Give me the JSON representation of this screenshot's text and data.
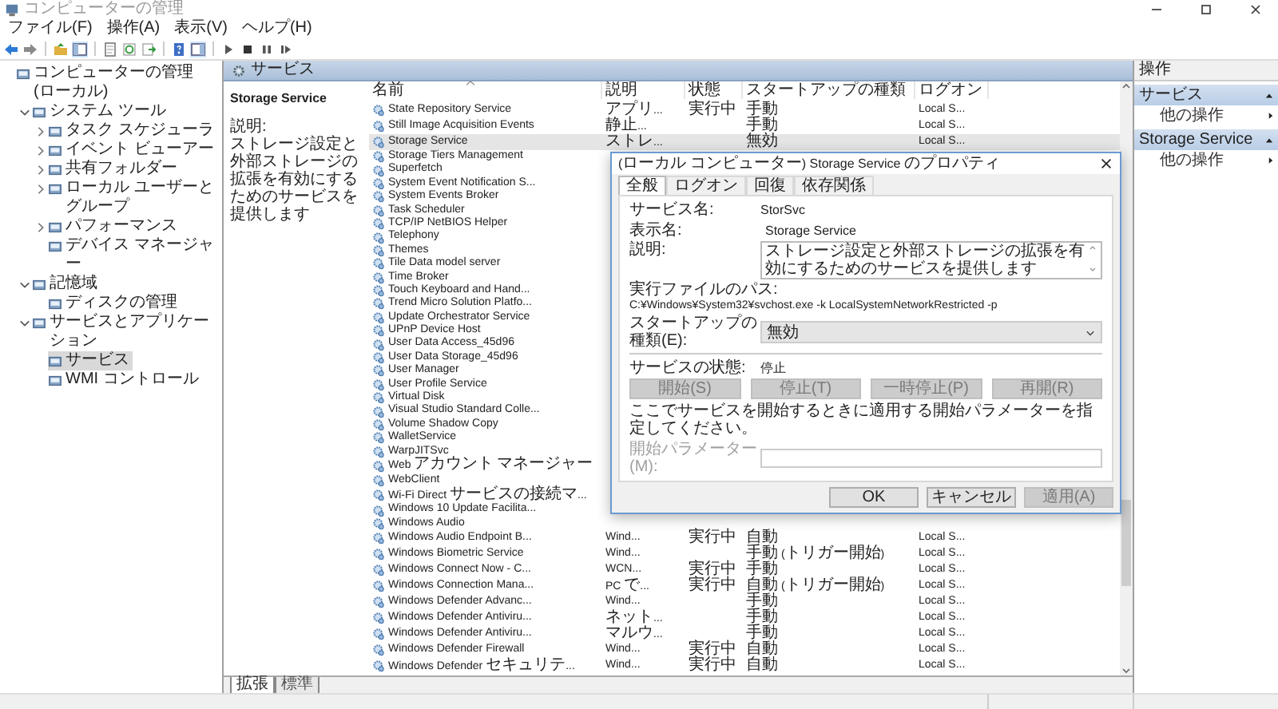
{
  "window": {
    "title": "コンピューターの管理"
  },
  "menu": [
    "ファイル(F)",
    "操作(A)",
    "表示(V)",
    "ヘルプ(H)"
  ],
  "tree": [
    {
      "label": "コンピューターの管理 (ローカル)",
      "selected": false,
      "children": [
        {
          "label": "システム ツール",
          "selected": false,
          "expanded": true,
          "children": [
            {
              "label": "タスク スケジューラ",
              "selected": false,
              "expanded": false
            },
            {
              "label": "イベント ビューアー",
              "selected": false,
              "expanded": false
            },
            {
              "label": "共有フォルダー",
              "selected": false,
              "expanded": false
            },
            {
              "label": "ローカル ユーザーとグループ",
              "selected": false,
              "expanded": false
            },
            {
              "label": "パフォーマンス",
              "selected": false,
              "expanded": false
            },
            {
              "label": "デバイス マネージャー",
              "selected": false
            }
          ]
        },
        {
          "label": "記憶域",
          "selected": false,
          "expanded": true,
          "children": [
            {
              "label": "ディスクの管理",
              "selected": false
            }
          ]
        },
        {
          "label": "サービスとアプリケーション",
          "selected": false,
          "expanded": true,
          "children": [
            {
              "label": "サービス",
              "selected": true
            },
            {
              "label": "WMI コントロール",
              "selected": false
            }
          ]
        }
      ]
    }
  ],
  "services_panel": {
    "title": "サービス",
    "description_pane": {
      "name": "Storage Service",
      "label": "説明:",
      "text": "ストレージ設定と外部ストレージの拡張を有効にするためのサービスを提供します"
    },
    "columns": [
      "名前",
      "説明",
      "状態",
      "スタートアップの種類",
      "ログオン"
    ],
    "rows": [
      {
        "name": "State Repository Service",
        "description": "アプリ...",
        "status": "実行中",
        "startup": "手動",
        "logon": "Local S...",
        "selected": false
      },
      {
        "name": "Still Image Acquisition Events",
        "description": "静止...",
        "startup": "手動",
        "logon": "Local S...",
        "selected": false
      },
      {
        "name": "Storage Service",
        "description": "ストレ...",
        "startup": "無効",
        "logon": "Local S...",
        "selected": true
      },
      {
        "name": "Storage Tiers Management",
        "selected": false
      },
      {
        "name": "Superfetch",
        "selected": false
      },
      {
        "name": "System Event Notification S...",
        "selected": false
      },
      {
        "name": "System Events Broker",
        "selected": false
      },
      {
        "name": "Task Scheduler",
        "selected": false
      },
      {
        "name": "TCP/IP NetBIOS Helper",
        "selected": false
      },
      {
        "name": "Telephony",
        "selected": false
      },
      {
        "name": "Themes",
        "selected": false
      },
      {
        "name": "Tile Data model server",
        "selected": false
      },
      {
        "name": "Time Broker",
        "selected": false
      },
      {
        "name": "Touch Keyboard and Hand...",
        "selected": false
      },
      {
        "name": "Trend Micro Solution Platfo...",
        "selected": false
      },
      {
        "name": "Update Orchestrator Service",
        "selected": false
      },
      {
        "name": "UPnP Device Host",
        "selected": false
      },
      {
        "name": "User Data Access_45d96",
        "selected": false
      },
      {
        "name": "User Data Storage_45d96",
        "selected": false
      },
      {
        "name": "User Manager",
        "selected": false
      },
      {
        "name": "User Profile Service",
        "selected": false
      },
      {
        "name": "Virtual Disk",
        "selected": false
      },
      {
        "name": "Visual Studio Standard Colle...",
        "selected": false
      },
      {
        "name": "Volume Shadow Copy",
        "selected": false
      },
      {
        "name": "WalletService",
        "selected": false
      },
      {
        "name": "WarpJITSvc",
        "selected": false
      },
      {
        "name": "Web アカウント マネージャー",
        "selected": false
      },
      {
        "name": "WebClient",
        "selected": false
      },
      {
        "name": "Wi-Fi Direct サービスの接続マ...",
        "selected": false
      },
      {
        "name": "Windows 10 Update Facilita...",
        "selected": false
      },
      {
        "name": "Windows Audio",
        "selected": false
      },
      {
        "name": "Windows Audio Endpoint B...",
        "description": "Wind...",
        "status": "実行中",
        "startup": "自動",
        "logon": "Local S...",
        "selected": false
      },
      {
        "name": "Windows Biometric Service",
        "description": "Wind...",
        "startup": "手動 (トリガー開始)",
        "logon": "Local S...",
        "selected": false
      },
      {
        "name": "Windows Connect Now - C...",
        "description": "WCN...",
        "status": "実行中",
        "startup": "手動",
        "logon": "Local S...",
        "selected": false
      },
      {
        "name": "Windows Connection Mana...",
        "description": "PC で...",
        "status": "実行中",
        "startup": "自動 (トリガー開始)",
        "logon": "Local S...",
        "selected": false
      },
      {
        "name": "Windows Defender Advanc...",
        "description": "Wind...",
        "startup": "手動",
        "logon": "Local S...",
        "selected": false
      },
      {
        "name": "Windows Defender Antiviru...",
        "description": "ネット...",
        "startup": "手動",
        "logon": "Local S...",
        "selected": false
      },
      {
        "name": "Windows Defender Antiviru...",
        "description": "マルウ...",
        "startup": "手動",
        "logon": "Local S...",
        "selected": false
      },
      {
        "name": "Windows Defender Firewall",
        "description": "Wind...",
        "status": "実行中",
        "startup": "自動",
        "logon": "Local S...",
        "selected": false
      },
      {
        "name": "Windows Defender セキュリテ...",
        "description": "Wind...",
        "status": "実行中",
        "startup": "自動",
        "logon": "Local S...",
        "selected": false
      }
    ],
    "view_tabs": [
      {
        "label": "拡張",
        "selected": true
      },
      {
        "label": "標準",
        "selected": false
      }
    ]
  },
  "actions": {
    "title": "操作",
    "sections": [
      {
        "title": "サービス",
        "items": [
          "他の操作"
        ]
      },
      {
        "title": "Storage Service",
        "items": [
          "他の操作"
        ]
      }
    ]
  },
  "dialog": {
    "title": "(ローカル コンピューター) Storage Service のプロパティ",
    "tabs": [
      {
        "label": "全般",
        "selected": true
      },
      {
        "label": "ログオン",
        "selected": false
      },
      {
        "label": "回復",
        "selected": false
      },
      {
        "label": "依存関係",
        "selected": false
      }
    ],
    "service_name": {
      "label": "サービス名:",
      "value": "StorSvc"
    },
    "display_name": {
      "label": "表示名:",
      "value": "Storage Service"
    },
    "description": {
      "label": "説明:",
      "value": "ストレージ設定と外部ストレージの拡張を有効にするためのサービスを提供します"
    },
    "path": {
      "label": "実行ファイルのパス:",
      "value": "C:¥Windows¥System32¥svchost.exe -k LocalSystemNetworkRestricted -p"
    },
    "startup_type": {
      "label": "スタートアップの種類(E):",
      "value": "無効"
    },
    "service_status": {
      "label": "サービスの状態:",
      "value": "停止"
    },
    "control_buttons": [
      {
        "label": "開始(S)",
        "disabled": true
      },
      {
        "label": "停止(T)",
        "disabled": true
      },
      {
        "label": "一時停止(P)",
        "disabled": true
      },
      {
        "label": "再開(R)",
        "disabled": true
      }
    ],
    "hint": "ここでサービスを開始するときに適用する開始パラメーターを指定してください。",
    "start_parameters": {
      "label": "開始パラメーター(M):",
      "disabled": true
    },
    "buttons": [
      {
        "label": "OK",
        "disabled": false
      },
      {
        "label": "キャンセル",
        "disabled": false
      },
      {
        "label": "適用(A)",
        "disabled": true
      }
    ]
  }
}
